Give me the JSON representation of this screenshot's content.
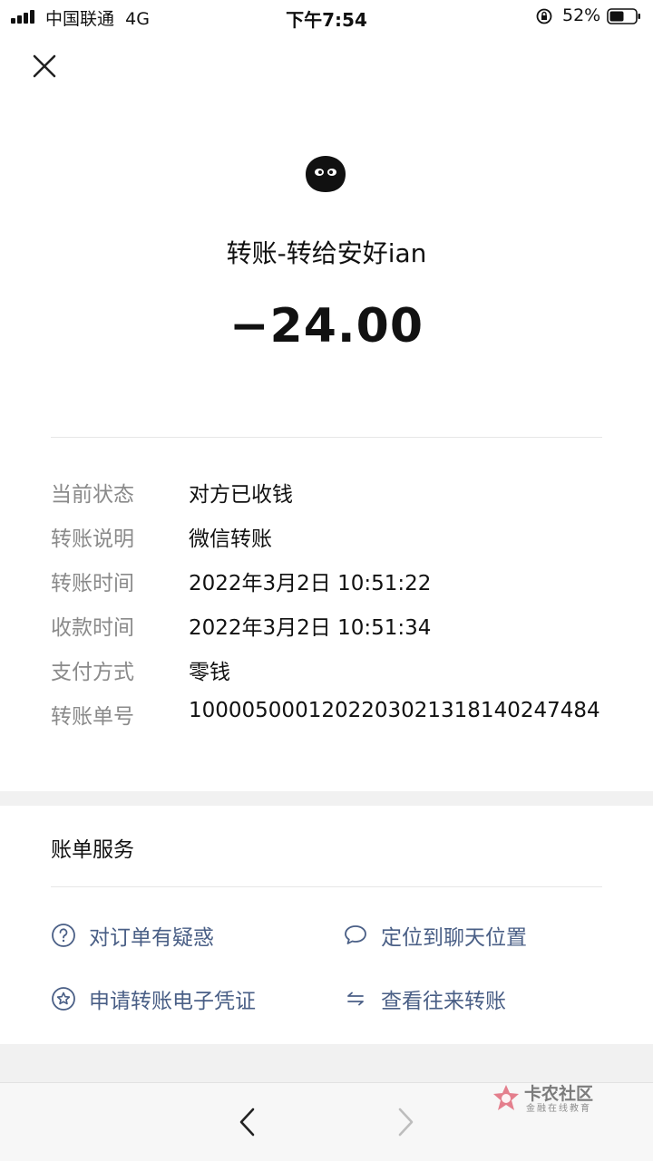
{
  "status_bar": {
    "carrier": "中国联通",
    "network": "4G",
    "time": "下午7:54",
    "battery": "52%"
  },
  "transaction": {
    "title": "转账-转给安好ian",
    "amount": "−24.00"
  },
  "details": [
    {
      "label": "当前状态",
      "value": "对方已收钱"
    },
    {
      "label": "转账说明",
      "value": "微信转账"
    },
    {
      "label": "转账时间",
      "value": "2022年3月2日 10:51:22"
    },
    {
      "label": "收款时间",
      "value": "2022年3月2日 10:51:34"
    },
    {
      "label": "支付方式",
      "value": "零钱"
    },
    {
      "label": "转账单号",
      "value": "1000050001202203021318140247484"
    }
  ],
  "services": {
    "title": "账单服务",
    "items": [
      {
        "label": "对订单有疑惑",
        "icon": "question-circle-icon"
      },
      {
        "label": "定位到聊天位置",
        "icon": "chat-bubble-icon"
      },
      {
        "label": "申请转账电子凭证",
        "icon": "star-circle-icon"
      },
      {
        "label": "查看往来转账",
        "icon": "transfer-arrows-icon"
      }
    ]
  },
  "watermark": {
    "name": "卡农社区",
    "subtitle": "金融在线教育"
  },
  "colors": {
    "link": "#4a5f86",
    "label_gray": "#8a8a8a",
    "section_gap": "#f1f1f1"
  }
}
